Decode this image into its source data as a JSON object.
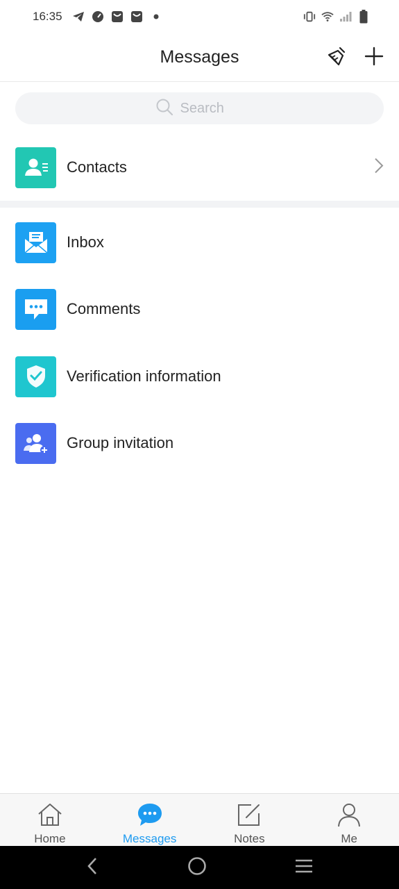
{
  "status_bar": {
    "time": "16:35",
    "icons": [
      "telegram-icon",
      "speedometer-icon",
      "mail-bag-icon",
      "mail-bag-icon",
      "dot-icon",
      "vibrate-icon",
      "wifi-icon",
      "signal-icon",
      "battery-icon"
    ]
  },
  "header": {
    "title": "Messages",
    "icons": [
      "broom-icon",
      "plus-icon"
    ]
  },
  "search": {
    "placeholder": "Search"
  },
  "list": {
    "contacts": {
      "label": "Contacts",
      "icon": "contact-card-icon",
      "color": "#22c7b3"
    },
    "items": [
      {
        "label": "Inbox",
        "icon": "envelope-icon",
        "color": "#1da1f2"
      },
      {
        "label": "Comments",
        "icon": "chat-bubble-icon",
        "color": "#1a9ef0"
      },
      {
        "label": "Verification information",
        "icon": "shield-check-icon",
        "color": "#1fc6cf"
      },
      {
        "label": "Group invitation",
        "icon": "group-add-icon",
        "color": "#4a6cf0"
      }
    ]
  },
  "tabbar": {
    "tabs": [
      {
        "label": "Home",
        "icon": "home-icon"
      },
      {
        "label": "Messages",
        "icon": "chat-bubble-icon",
        "active": true
      },
      {
        "label": "Notes",
        "icon": "edit-icon"
      },
      {
        "label": "Me",
        "icon": "person-icon"
      }
    ],
    "active_color": "#1e9bf0"
  },
  "nav_bar": {
    "icons": [
      "back-icon",
      "home-circle-icon",
      "recents-icon"
    ]
  }
}
